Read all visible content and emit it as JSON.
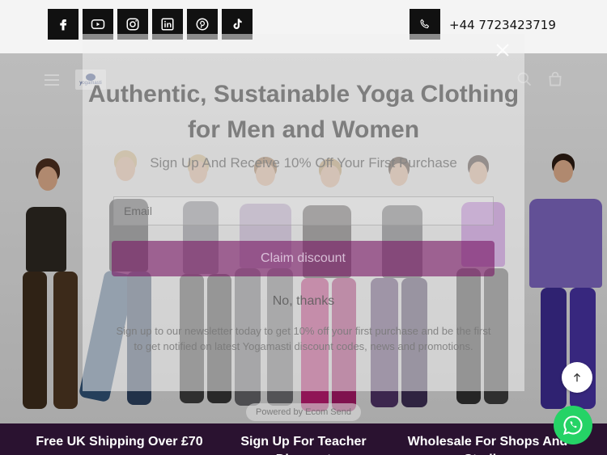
{
  "topbar": {
    "social_icons": [
      "facebook-icon",
      "youtube-icon",
      "instagram-icon",
      "linkedin-icon",
      "pinterest-icon",
      "tiktok-icon"
    ],
    "phone_icon": "phone-icon",
    "phone_number": "+44 7723423719"
  },
  "nav": {
    "logo_text": "yogamasti",
    "menu_icon": "hamburger-icon",
    "search_icon": "search-icon",
    "cart_icon": "bag-icon"
  },
  "popup": {
    "title": "Authentic, Sustainable Yoga Clothing for Men and Women",
    "subtitle": "Sign Up And Receive 10% Off Your First Purchase",
    "email_placeholder": "Email",
    "claim_label": "Claim discount",
    "no_thanks_label": "No, thanks",
    "fine_print": "Sign up to our newsletter today to get 10% off your first purchase and be the first to get notified on latest Yogamasti discount codes, news and promotions.",
    "powered_by": "Powered by Ecom Send"
  },
  "bottombar": {
    "promos": [
      "Free UK Shipping Over £70",
      "Sign Up For Teacher Discount",
      "Wholesale For Shops And Studios"
    ]
  },
  "colors": {
    "accent": "#7a1466",
    "bottombar": "#2a1230",
    "whatsapp": "#25d366"
  }
}
